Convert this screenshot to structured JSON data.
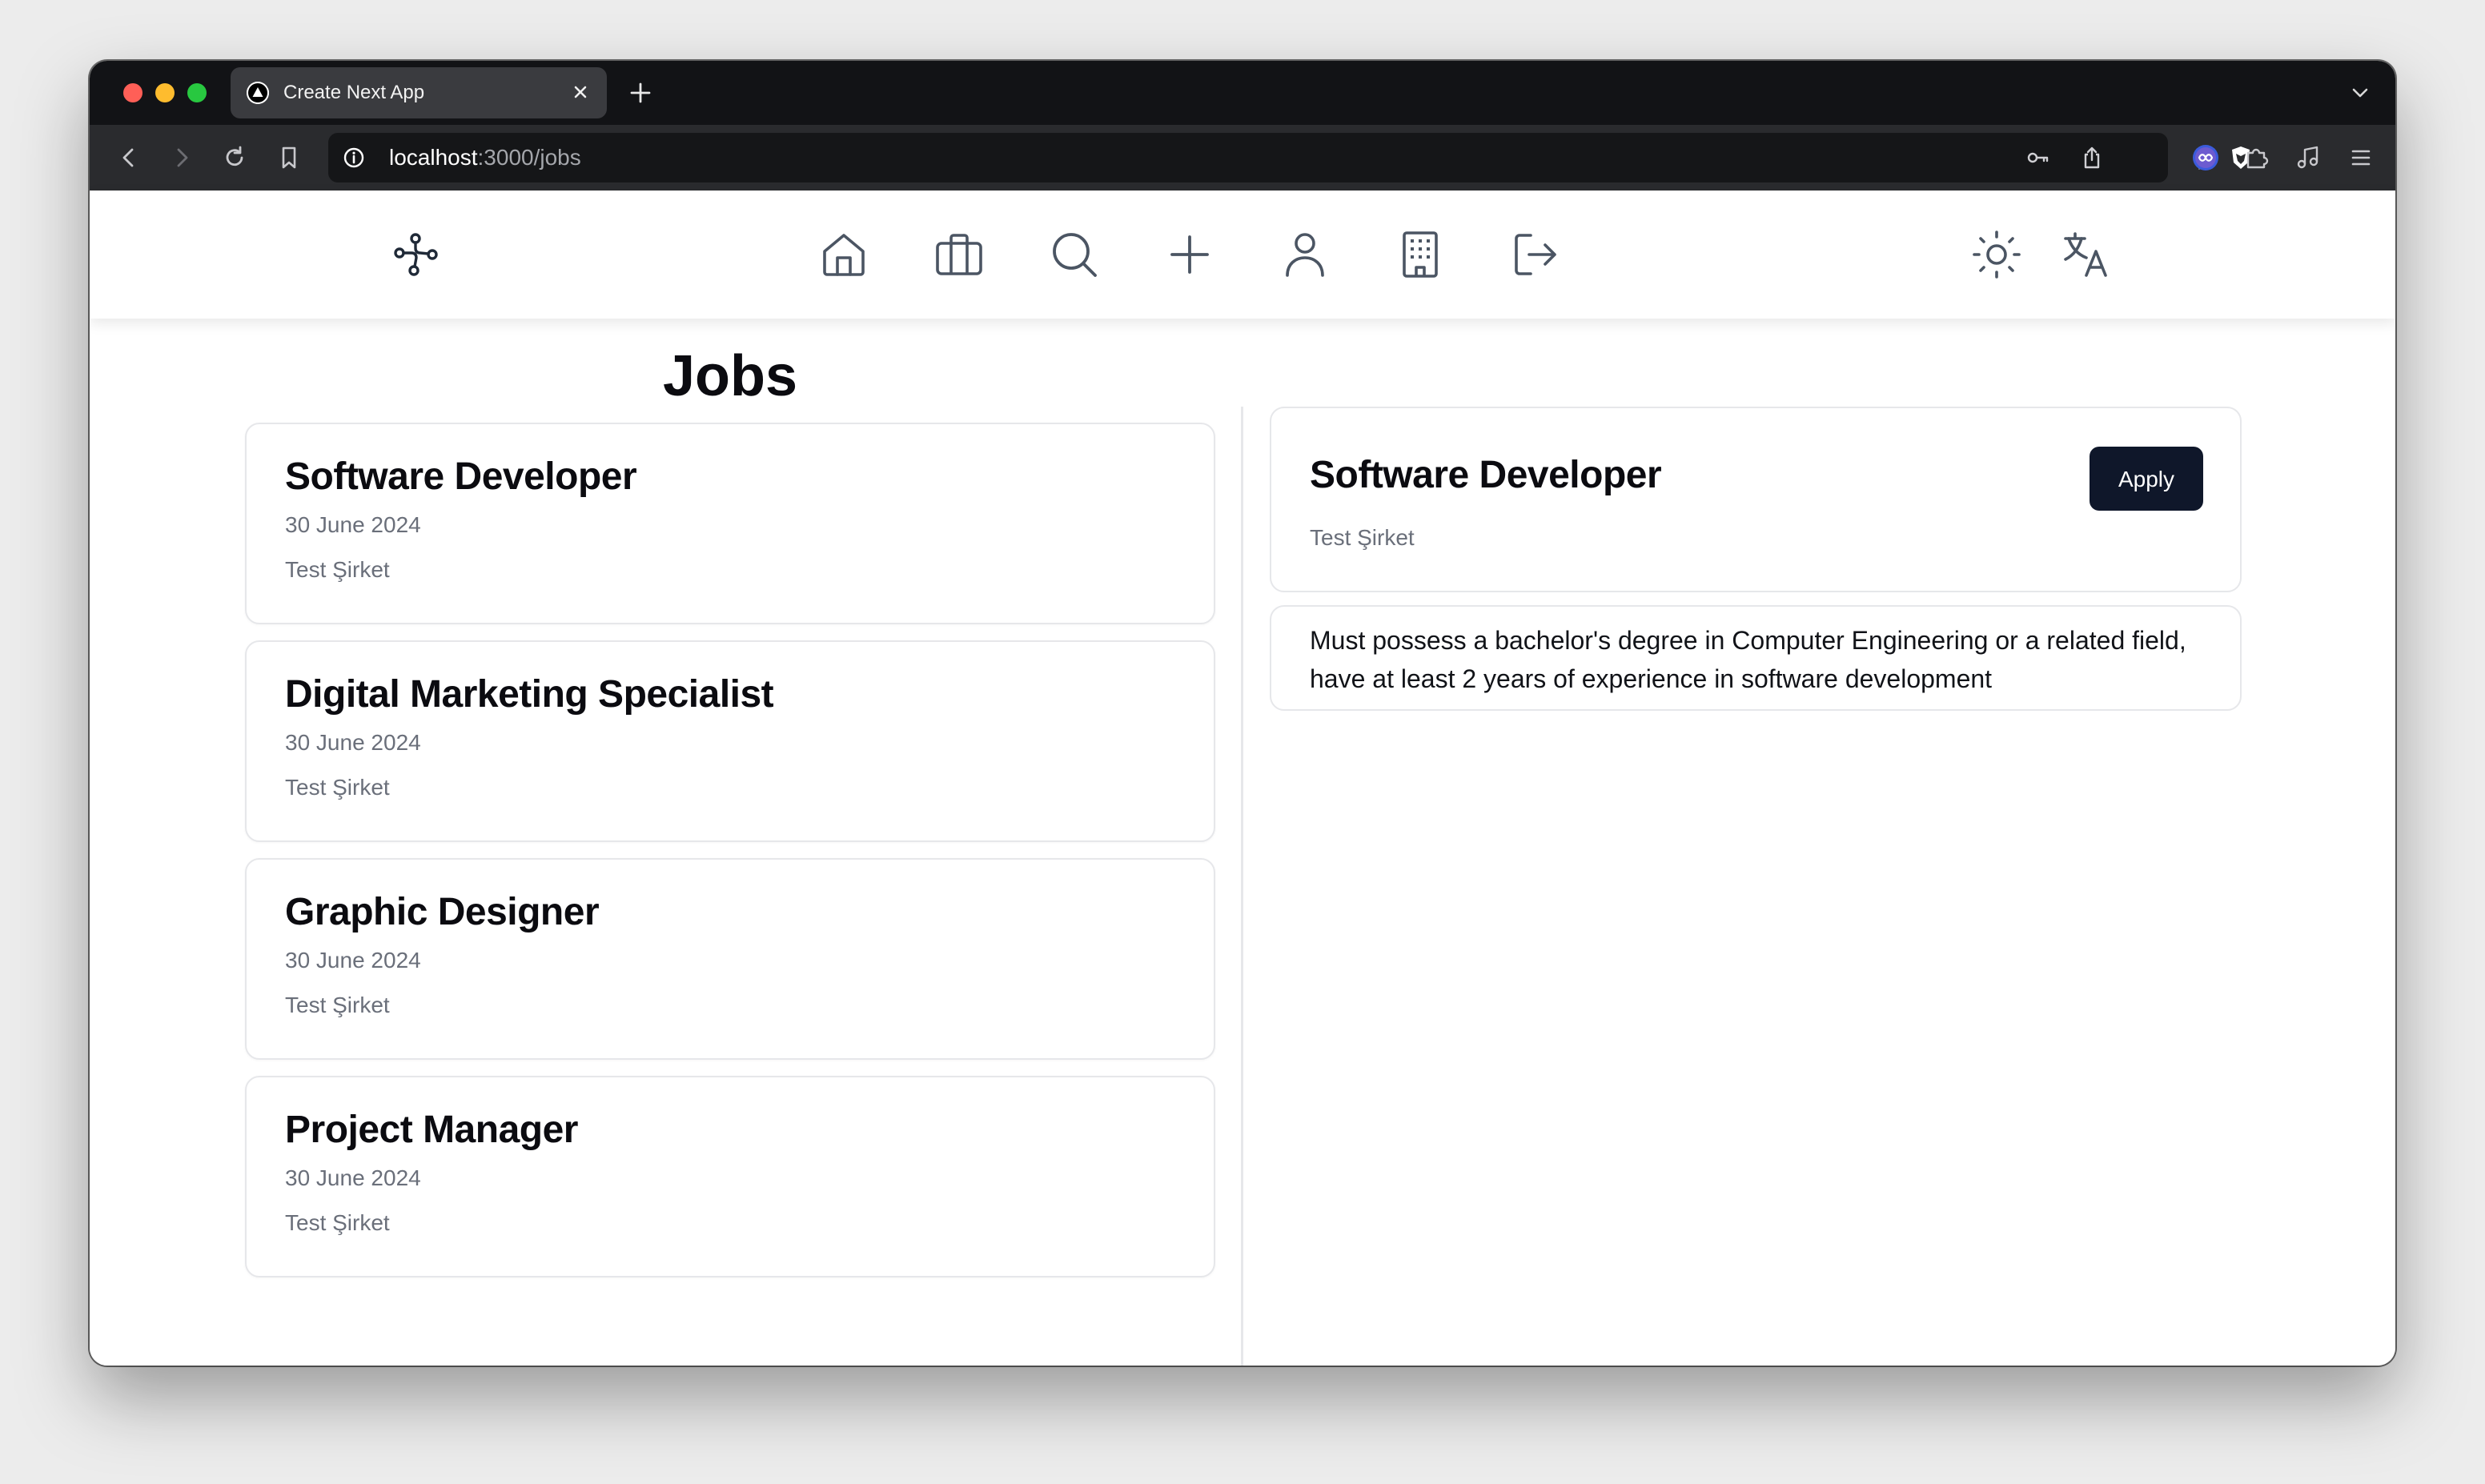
{
  "browser": {
    "tab": {
      "title": "Create Next App",
      "favicon": "nextjs-triangle-icon"
    },
    "url": {
      "host": "localhost",
      "path": ":3000/jobs"
    },
    "colors": {
      "tabbar": "#121316",
      "toolbar": "#2a2b2e",
      "urlbar": "#151618"
    }
  },
  "navbar": {
    "icons": [
      "logo-network-icon",
      "home-icon",
      "briefcase-icon",
      "search-icon",
      "plus-icon",
      "user-icon",
      "building-icon",
      "logout-icon",
      "sun-icon",
      "translate-icon"
    ]
  },
  "jobs": {
    "heading": "Jobs",
    "list": [
      {
        "title": "Software Developer",
        "date": "30 June 2024",
        "company": "Test Şirket"
      },
      {
        "title": "Digital Marketing Specialist",
        "date": "30 June 2024",
        "company": "Test Şirket"
      },
      {
        "title": "Graphic Designer",
        "date": "30 June 2024",
        "company": "Test Şirket"
      },
      {
        "title": "Project Manager",
        "date": "30 June 2024",
        "company": "Test Şirket"
      }
    ]
  },
  "detail": {
    "title": "Software Developer",
    "company": "Test Şirket",
    "apply_label": "Apply",
    "description": "Must possess a bachelor's degree in Computer Engineering or a related field, have at least 2 years of experience in software development",
    "colors": {
      "apply_bg": "#0f172a",
      "apply_text": "#ffffff"
    }
  }
}
